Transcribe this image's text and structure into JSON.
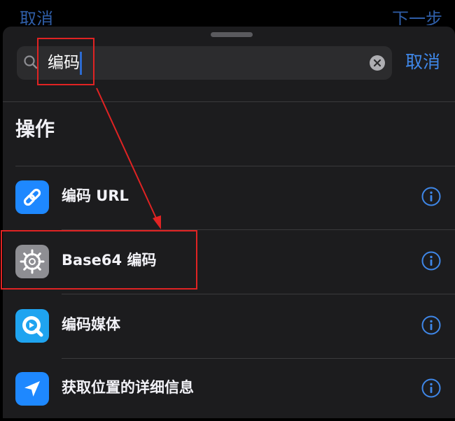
{
  "background_nav": {
    "left_label": "取消",
    "right_label": "下一步"
  },
  "search": {
    "value": "编码",
    "cancel_label": "取消"
  },
  "section": {
    "title": "操作"
  },
  "actions": [
    {
      "label": "编码 URL",
      "icon": "link-icon",
      "icon_bg": "#1e88ff"
    },
    {
      "label": "Base64 编码",
      "icon": "gear-icon",
      "icon_bg": "#8e8e93"
    },
    {
      "label": "编码媒体",
      "icon": "quicktime-icon",
      "icon_bg": "#1fa4f0"
    },
    {
      "label": "获取位置的详细信息",
      "icon": "location-arrow-icon",
      "icon_bg": "#1e88ff"
    }
  ],
  "colors": {
    "accent": "#3f87e8",
    "sheet_bg": "#1c1c1e",
    "annotation": "#e02323"
  }
}
